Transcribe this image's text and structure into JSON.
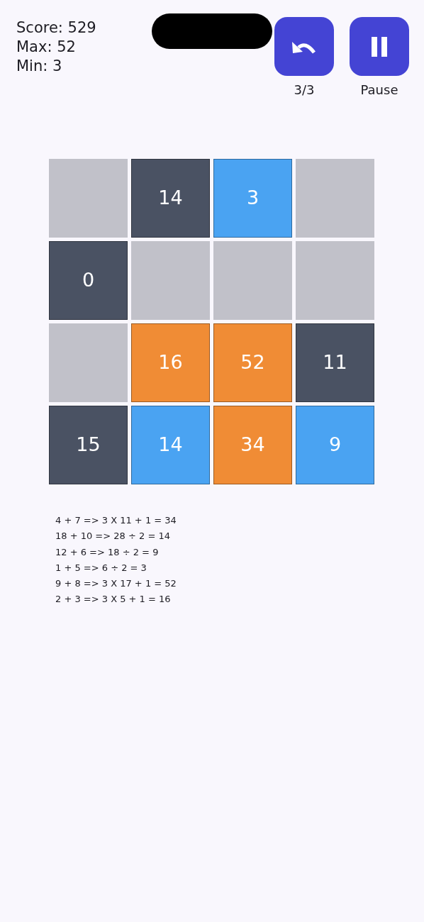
{
  "stats": [
    "Score: 529",
    "Max: 52",
    "Min: 3"
  ],
  "buttons": [
    {
      "kind": "undo",
      "label": "3/3"
    },
    {
      "kind": "pause",
      "label": "Pause"
    }
  ],
  "board": [
    [
      {
        "kind": "empty"
      },
      {
        "kind": "dark",
        "value": "14"
      },
      {
        "kind": "blue",
        "value": "3"
      },
      {
        "kind": "empty"
      }
    ],
    [
      {
        "kind": "dark",
        "value": "0"
      },
      {
        "kind": "empty"
      },
      {
        "kind": "empty"
      },
      {
        "kind": "empty"
      }
    ],
    [
      {
        "kind": "empty"
      },
      {
        "kind": "orange",
        "value": "16"
      },
      {
        "kind": "orange",
        "value": "52"
      },
      {
        "kind": "dark",
        "value": "11"
      }
    ],
    [
      {
        "kind": "dark",
        "value": "15"
      },
      {
        "kind": "blue",
        "value": "14"
      },
      {
        "kind": "orange",
        "value": "34"
      },
      {
        "kind": "blue",
        "value": "9"
      }
    ]
  ],
  "history": [
    "4 + 7 => 3 X 11 + 1 = 34",
    "18 + 10 => 28 ÷ 2 = 14",
    "12 + 6 => 18 ÷ 2 = 9",
    "1 + 5 => 6 ÷ 2 = 3",
    "9 + 8 => 3 X 17 + 1 = 52",
    "2 + 3 => 3 X 5 + 1 = 16"
  ]
}
